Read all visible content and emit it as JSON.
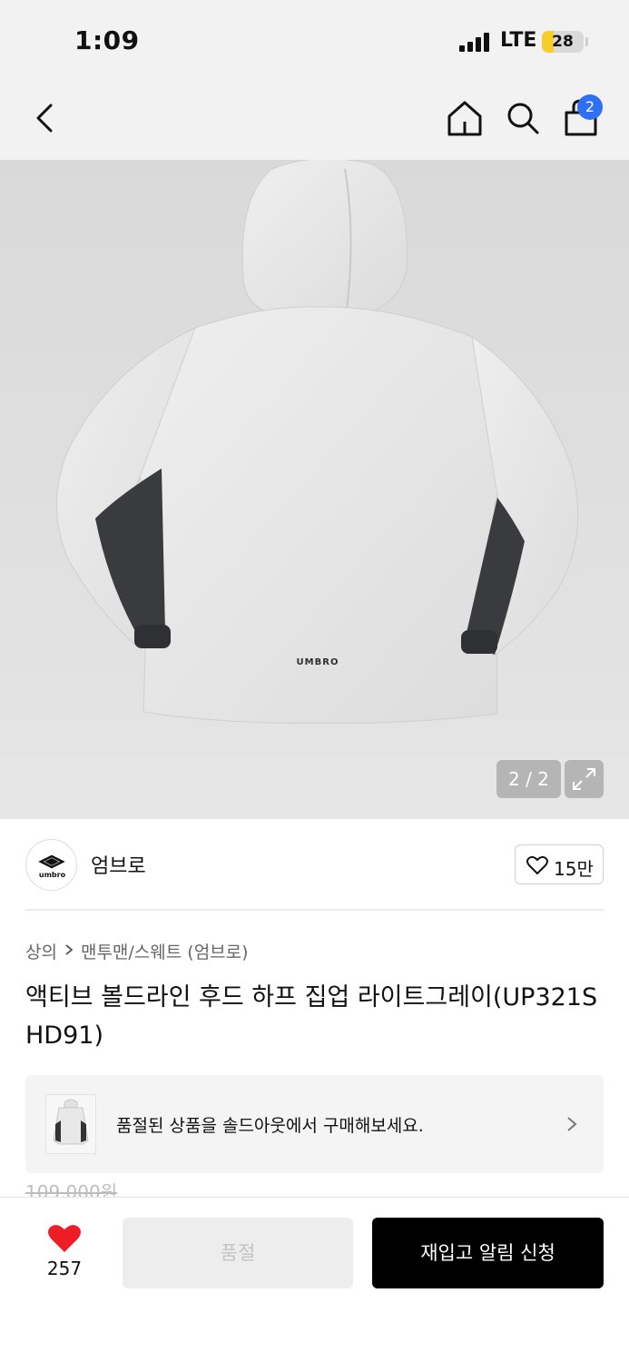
{
  "status_bar": {
    "time": "1:09",
    "network": "LTE",
    "battery": "28",
    "battery_level": 0.28
  },
  "nav": {
    "cart_count": "2"
  },
  "gallery": {
    "page_indicator": "2 / 2",
    "garment_print": "UMBRO"
  },
  "brand": {
    "name": "엄브로",
    "logo_text": "umbro",
    "likes": "15만"
  },
  "breadcrumb": {
    "category": "상의",
    "subcategory": "맨투맨/스웨트 (엄브로)"
  },
  "product": {
    "title": "액티브 볼드라인 후드 하프 집업 라이트그레이(UP321SHD91)",
    "original_price": "109,000원"
  },
  "soldout_banner": {
    "text": "품절된 상품을 솔드아웃에서 구매해보세요."
  },
  "bottom_bar": {
    "wish_count": "257",
    "soldout_label": "품절",
    "restock_label": "재입고 알림 신청"
  },
  "colors": {
    "accent_blue": "#2f6ff5",
    "heart_red": "#ee1c25",
    "battery_yellow": "#f7cd2c"
  }
}
